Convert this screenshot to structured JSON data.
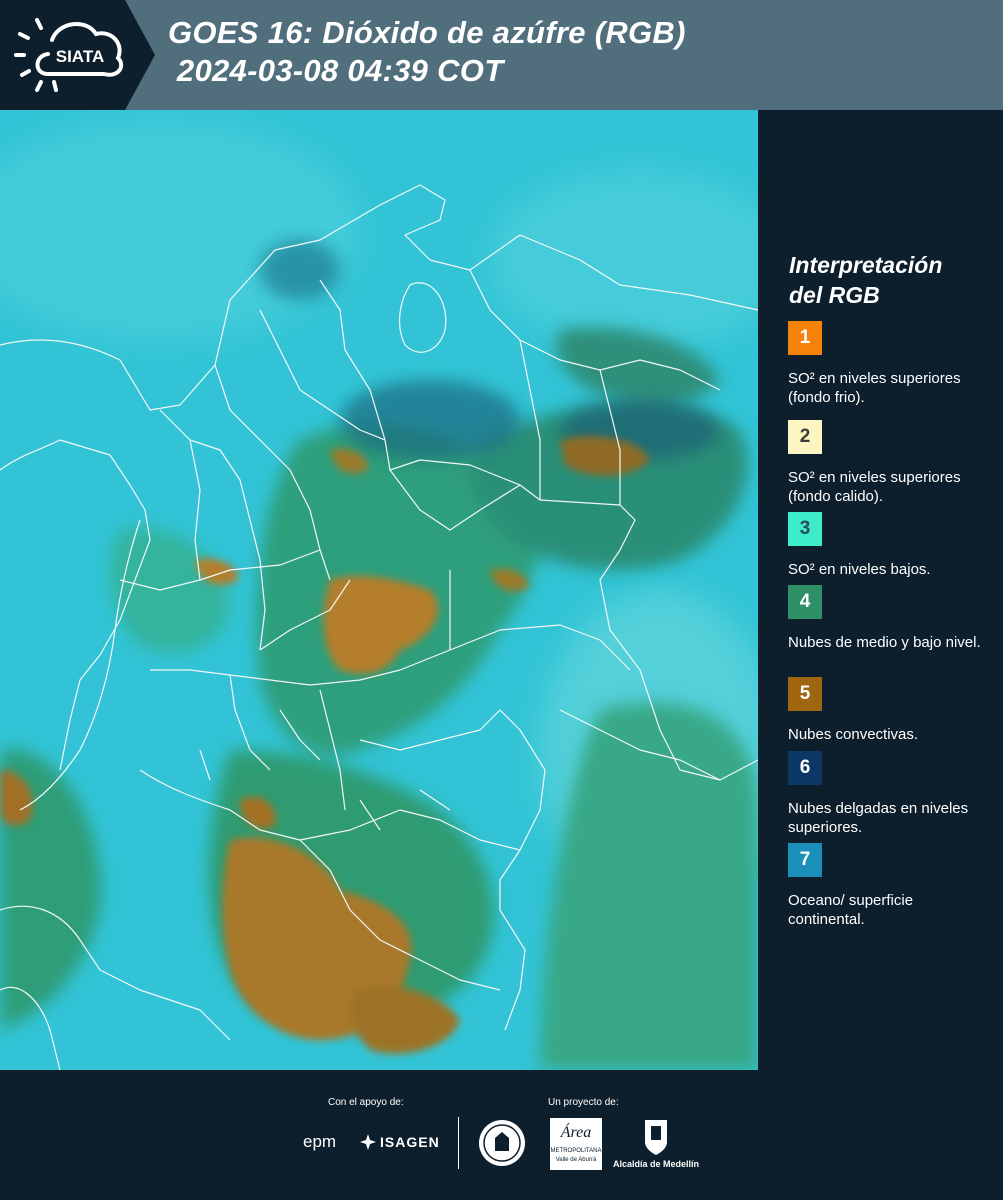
{
  "header": {
    "logo_text": "SIATA",
    "title_line1": "GOES 16: Dióxido de azúfre (RGB)",
    "title_line2": " 2024-03-08 04:39 COT"
  },
  "legend": {
    "title_line1": "Interpretación",
    "title_line2": "del RGB",
    "items": [
      {
        "number": "1",
        "color": "#f7820a",
        "number_color": "#ffffff",
        "text": "SO² en niveles superiores (fondo frio)."
      },
      {
        "number": "2",
        "color": "#fdf6c2",
        "number_color": "#3c3c3c",
        "text": "SO² en niveles superiores (fondo calido)."
      },
      {
        "number": "3",
        "color": "#3deccb",
        "number_color": "#2b4a55",
        "text": "SO² en niveles bajos."
      },
      {
        "number": "4",
        "color": "#2f8f66",
        "number_color": "#ffffff",
        "text": "Nubes de medio y bajo nivel."
      },
      {
        "number": "5",
        "color": "#a0650f",
        "number_color": "#ffffff",
        "text": "Nubes convectivas."
      },
      {
        "number": "6",
        "color": "#0d3766",
        "number_color": "#ffffff",
        "text": "Nubes delgadas en niveles superiores."
      },
      {
        "number": "7",
        "color": "#1a8fb8",
        "number_color": "#ffffff",
        "text": "Oceano/ superficie continental."
      }
    ]
  },
  "footer": {
    "support_label": "Con el apoyo de:",
    "project_label": "Un proyecto de:",
    "sponsor_epm": "epm",
    "sponsor_isagen": "ISAGEN",
    "area_logo_text": "Área",
    "area_line1": "METROPOLITANA",
    "area_line2": "Valle de Aburrá",
    "alcaldia_label": "Alcaldía de Medellín"
  }
}
